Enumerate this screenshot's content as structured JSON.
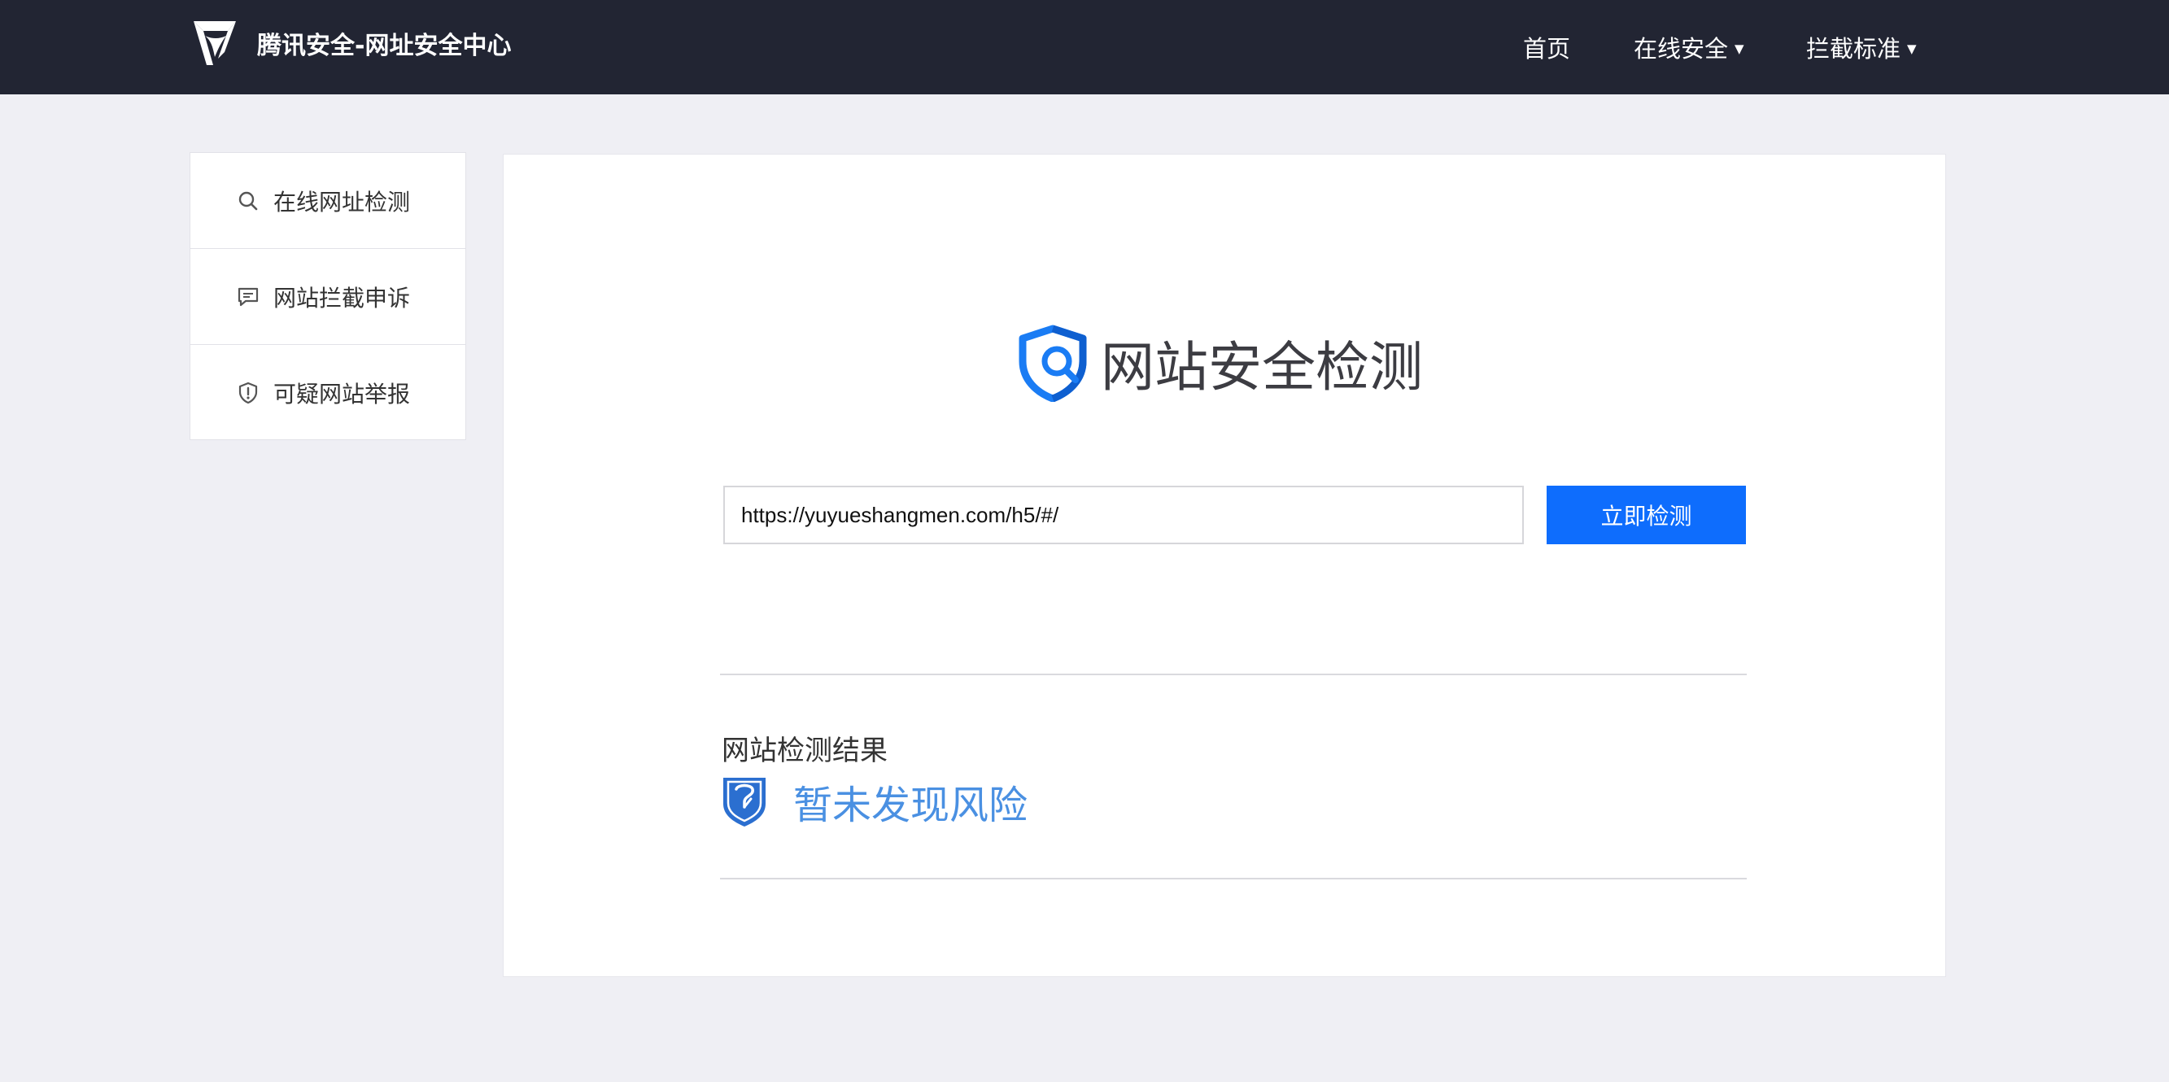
{
  "header": {
    "brand_title": "腾讯安全-网址安全中心",
    "nav": {
      "home": "首页",
      "online_security": "在线安全",
      "block_standard": "拦截标准",
      "caret": "▼"
    }
  },
  "sidebar": {
    "items": [
      {
        "label": "在线网址检测",
        "icon": "search-icon"
      },
      {
        "label": "网站拦截申诉",
        "icon": "message-icon"
      },
      {
        "label": "可疑网站举报",
        "icon": "shield-alert-icon"
      }
    ]
  },
  "main": {
    "hero_title": "网站安全检测",
    "url_value": "https://yuyueshangmen.com/h5/#/",
    "check_button": "立即检测",
    "result_title": "网站检测结果",
    "result_status": "暂未发现风险"
  },
  "colors": {
    "header_bg": "#222533",
    "page_bg": "#efeff4",
    "accent_blue": "#0e6dfd",
    "result_blue": "#4a90e2"
  }
}
